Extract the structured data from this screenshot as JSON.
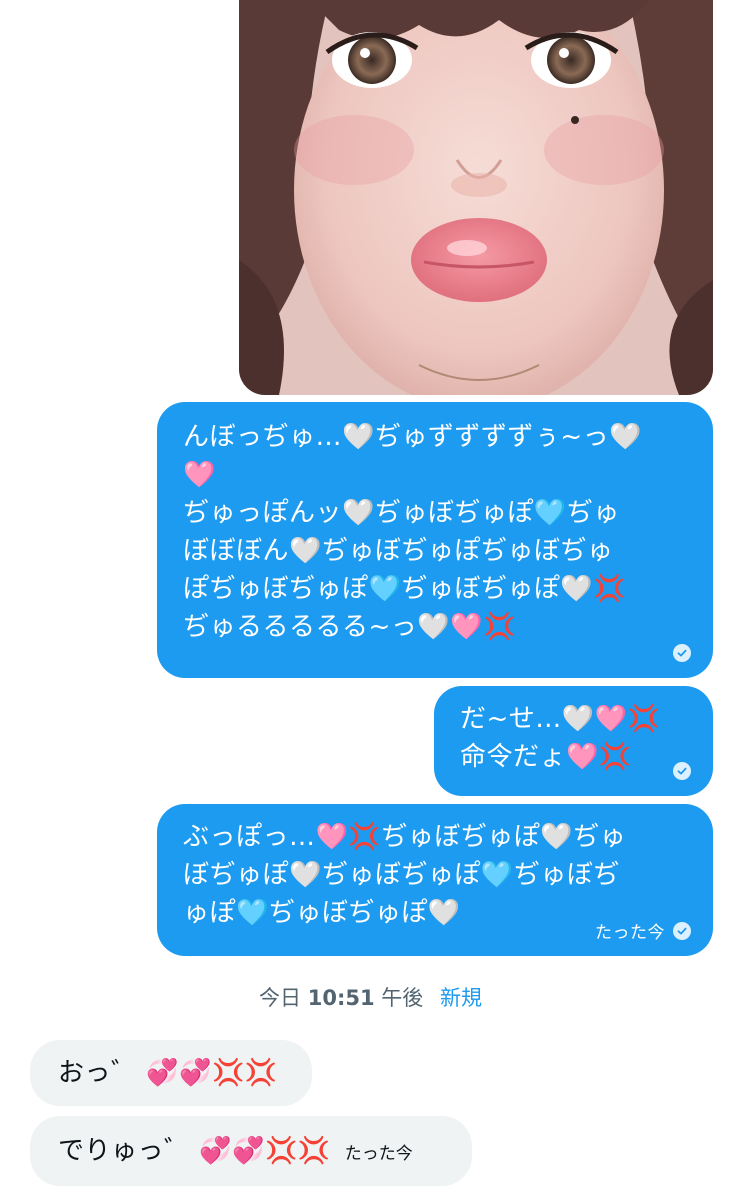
{
  "messages": {
    "sent": [
      {
        "lines": [
          "んぼっぢゅ…🤍ぢゅずずずずぅ~っ🤍",
          "🩷",
          "ぢゅっぽんッ🤍ぢゅぼぢゅぽ🩵ぢゅ",
          "ぼぼぼん🤍ぢゅぼぢゅぽぢゅぼぢゅ",
          "ぽぢゅぼぢゅぽ🩵ぢゅぼぢゅぽ🤍💢",
          "ぢゅるるるるる~っ🤍🩷💢"
        ]
      },
      {
        "lines": [
          "だ~せ…🤍🩷💢",
          "命令だょ🩷💢"
        ]
      },
      {
        "lines": [
          "ぶっぽっ…🩷💢ぢゅぼぢゅぽ🤍ぢゅ",
          "ぼぢゅぽ🤍ぢゅぼぢゅぽ🩵ぢゅぼぢ",
          "ゅぽ🩵ぢゅぼぢゅぽ🤍"
        ],
        "timestamp": "たった今"
      }
    ],
    "divider": {
      "date_prefix": "今日",
      "time": "10:51",
      "period": "午後",
      "new_label": "新規"
    },
    "received": [
      {
        "text": "おっ゛ 💞💞💢💢"
      },
      {
        "text": "でりゅっ゛ 💞💞💢💢",
        "timestamp": "たった今"
      }
    ]
  },
  "colors": {
    "sent_bubble": "#1d9bf0",
    "received_bubble": "#eff3f4",
    "accent": "#1d9bf0"
  },
  "icons": {
    "read_receipt": "check-circle-icon"
  }
}
